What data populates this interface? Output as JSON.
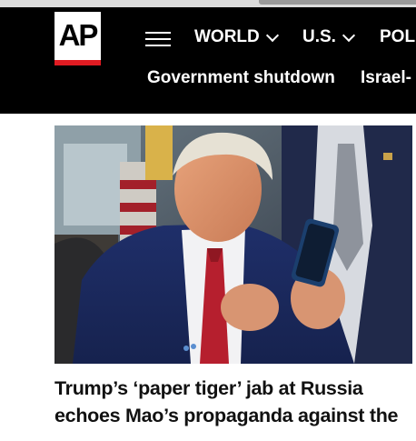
{
  "header": {
    "logo_text": "AP",
    "nav": [
      {
        "label": "WORLD"
      },
      {
        "label": "U.S."
      },
      {
        "label": "POLI"
      }
    ],
    "trending": [
      {
        "label": "Government shutdown"
      },
      {
        "label": "Israel-"
      }
    ]
  },
  "colors": {
    "header_bg": "#000000",
    "logo_red": "#e01b22",
    "headline": "#111111"
  },
  "article": {
    "image_description_icon": "photo",
    "headline": "Trump’s ‘paper tiger’ jab at Russia echoes Mao’s propaganda against the"
  }
}
